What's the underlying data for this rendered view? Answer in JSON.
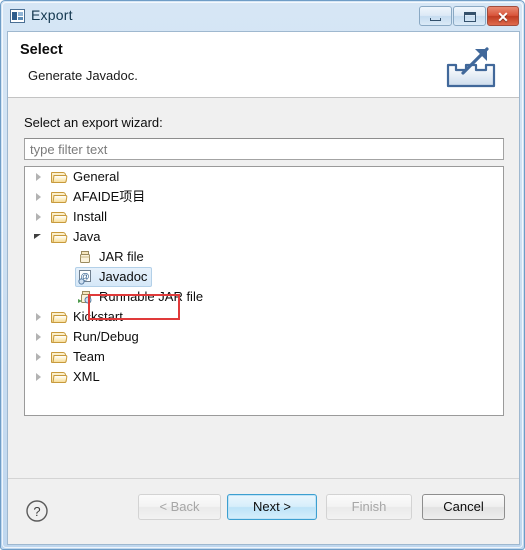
{
  "window": {
    "title": "Export",
    "icon": "export-wizard-icon",
    "controls": {
      "minimize": "Minimize",
      "maximize": "Restore",
      "close": "Close"
    }
  },
  "header": {
    "title": "Select",
    "description": "Generate Javadoc.",
    "icon": "export-banner-icon"
  },
  "body": {
    "wizard_label": "Select an export wizard:",
    "filter": {
      "value": "",
      "placeholder": "type filter text"
    }
  },
  "tree": {
    "items": [
      {
        "label": "General",
        "icon": "folder-icon",
        "state": "collapsed",
        "depth": 0,
        "selected": false
      },
      {
        "label": "AFAIDE项目",
        "icon": "folder-icon",
        "state": "collapsed",
        "depth": 0,
        "selected": false
      },
      {
        "label": "Install",
        "icon": "folder-icon",
        "state": "collapsed",
        "depth": 0,
        "selected": false
      },
      {
        "label": "Java",
        "icon": "folder-icon",
        "state": "expanded",
        "depth": 0,
        "selected": false
      },
      {
        "label": "JAR file",
        "icon": "jar-file-icon",
        "state": "leaf",
        "depth": 1,
        "selected": false
      },
      {
        "label": "Javadoc",
        "icon": "javadoc-icon",
        "state": "leaf",
        "depth": 1,
        "selected": true
      },
      {
        "label": "Runnable JAR file",
        "icon": "runnable-jar-icon",
        "state": "leaf",
        "depth": 1,
        "selected": false
      },
      {
        "label": "Kickstart",
        "icon": "folder-icon",
        "state": "collapsed",
        "depth": 0,
        "selected": false
      },
      {
        "label": "Run/Debug",
        "icon": "folder-icon",
        "state": "collapsed",
        "depth": 0,
        "selected": false
      },
      {
        "label": "Team",
        "icon": "folder-icon",
        "state": "collapsed",
        "depth": 0,
        "selected": false
      },
      {
        "label": "XML",
        "icon": "folder-icon",
        "state": "collapsed",
        "depth": 0,
        "selected": false
      }
    ]
  },
  "annotation": {
    "shape": "rectangle",
    "color": "#e03a3a",
    "target": "Javadoc"
  },
  "buttons": {
    "help": "?",
    "back": "< Back",
    "next": "Next >",
    "finish": "Finish",
    "cancel": "Cancel"
  },
  "colors": {
    "accent": "#3c9fd0",
    "annotation": "#e03a3a",
    "close_button": "#c03c22",
    "selection": "#d6e8f8"
  }
}
